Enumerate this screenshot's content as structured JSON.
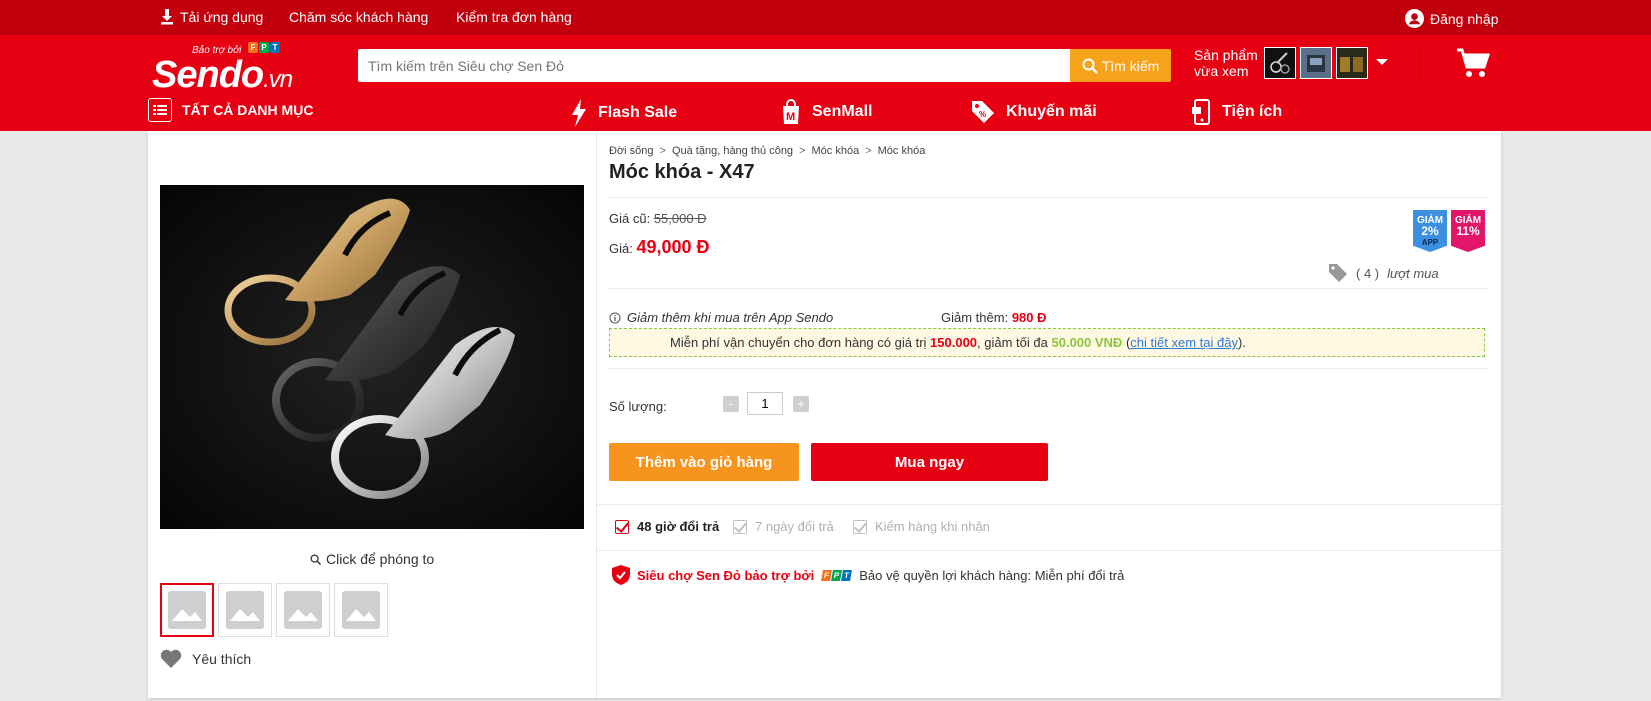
{
  "topbar": {
    "download_app": "Tải ứng dụng",
    "customer_care": "Chăm sóc khách hàng",
    "check_order": "Kiểm tra đơn hàng",
    "login": "Đăng nhập"
  },
  "header": {
    "logo_tag": "Bảo trợ bởi",
    "logo_text": "Sendo",
    "logo_suffix": ".vn",
    "fpt_letters": [
      "F",
      "P",
      "T"
    ],
    "search_placeholder": "Tìm kiếm trên Siêu chợ Sen Đỏ",
    "search_button": "Tìm kiếm",
    "recent_label_1": "Sản phẩm",
    "recent_label_2": "vừa xem",
    "brand_color": "#e60012",
    "accent_color": "#f7a21b"
  },
  "nav": {
    "all_categories": "TẤT CẢ DANH MỤC",
    "flash_sale": "Flash Sale",
    "senmall": "SenMall",
    "promotions": "Khuyến mãi",
    "utilities": "Tiện ích"
  },
  "product": {
    "breadcrumb": [
      "Đời sống",
      "Quà tặng, hàng thủ công",
      "Móc khóa",
      "Móc khóa"
    ],
    "title": "Móc khóa - X47",
    "old_price_label": "Giá cũ:",
    "old_price": "55,000 Đ",
    "price_label": "Giá:",
    "price": "49,000 Đ",
    "badge_app": {
      "line1": "GIẢM",
      "line2": "2%",
      "line3": "APP"
    },
    "badge_discount": {
      "line1": "GIẢM",
      "line2": "11%"
    },
    "sold_count": "( 4 )",
    "sold_label": "lượt mua",
    "app_discount_text": "Giảm thêm khi mua trên App Sendo",
    "extra_discount_label": "Giảm thêm:",
    "extra_discount_value": "980 Đ",
    "shipping": {
      "prefix": "Miễn phí vận chuyển cho đơn hàng có giá trị",
      "min_value": "150.000",
      "middle": ", giảm tối đa",
      "max_discount": "50.000 VNĐ",
      "open_paren": " (",
      "link": "chi tiết xem tại đây",
      "close": ")."
    },
    "quantity_label": "Số lượng:",
    "quantity": "1",
    "minus": "-",
    "plus": "+",
    "add_to_cart": "Thêm vào giỏ hàng",
    "buy_now": "Mua ngay",
    "features": [
      "48 giờ đổi trả",
      "7 ngày đổi trả",
      "Kiểm hàng khi nhận"
    ],
    "protection_red": "Siêu chợ Sen Đỏ bảo trợ bởi",
    "protection_text": "Bảo vệ quyền lợi khách hàng: Miễn phí đổi trả"
  },
  "gallery": {
    "zoom_hint": "Click để phóng to",
    "favorite": "Yêu thích"
  }
}
